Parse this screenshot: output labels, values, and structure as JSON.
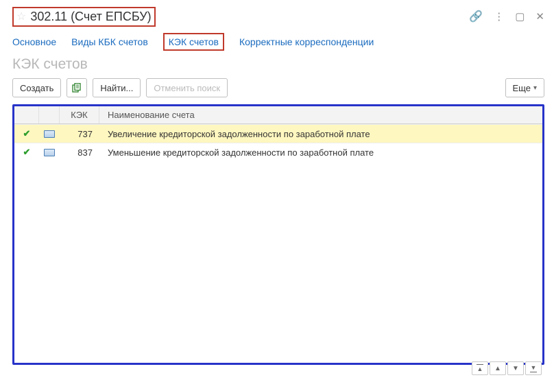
{
  "window": {
    "title": "302.11 (Счет ЕПСБУ)"
  },
  "tabs": {
    "main": "Основное",
    "kbk": "Виды КБК счетов",
    "kek": "КЭК счетов",
    "corr": "Корректные корреспонденции"
  },
  "section": {
    "heading": "КЭК счетов"
  },
  "toolbar": {
    "create": "Создать",
    "find": "Найти...",
    "cancel_search": "Отменить поиск",
    "more": "Еще"
  },
  "columns": {
    "kek": "КЭК",
    "name": "Наименование счета"
  },
  "rows": [
    {
      "kek": "737",
      "name": "Увеличение кредиторской задолженности по заработной плате"
    },
    {
      "kek": "837",
      "name": "Уменьшение кредиторской задолженности по заработной плате"
    }
  ]
}
